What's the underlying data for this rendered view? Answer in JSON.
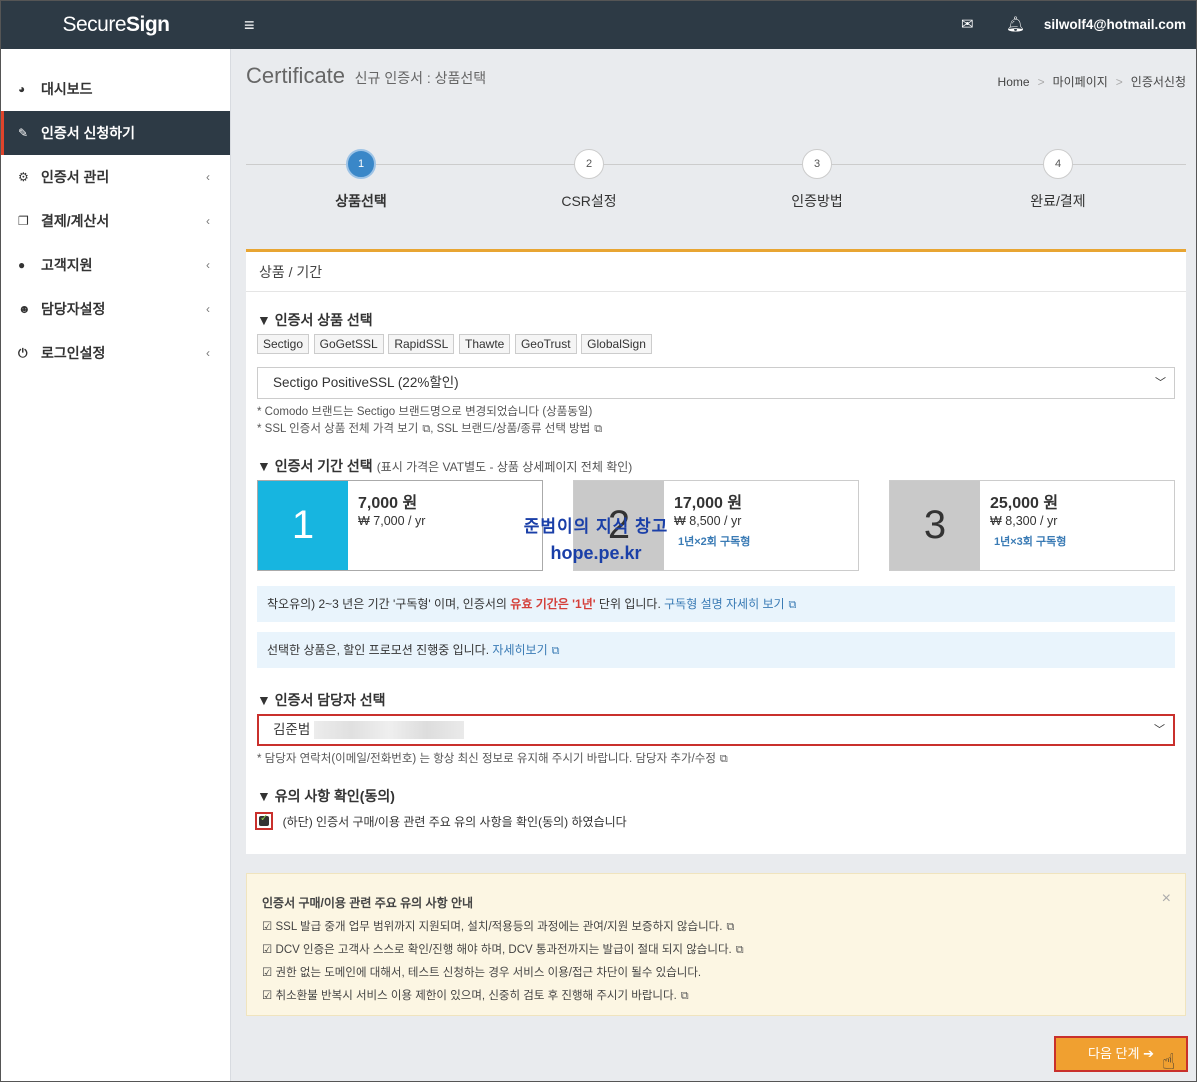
{
  "header": {
    "brand_light": "Secure",
    "brand_bold": "Sign",
    "menu_icon": "hamburger-icon",
    "mail_icon": "envelope-icon",
    "bell_icon": "bell-icon",
    "user_email": "silwolf4@hotmail.com"
  },
  "sidebar": {
    "items": [
      {
        "label": "대시보드",
        "icon": "dashboard-icon"
      },
      {
        "label": "인증서 신청하기",
        "icon": "edit-icon",
        "active": true
      },
      {
        "label": "인증서 관리",
        "icon": "cogs-icon"
      },
      {
        "label": "결제/계산서",
        "icon": "copy-icon"
      },
      {
        "label": "고객지원",
        "icon": "comments-icon"
      },
      {
        "label": "담당자설정",
        "icon": "users-icon"
      },
      {
        "label": "로그인설정",
        "icon": "power-icon"
      }
    ]
  },
  "page": {
    "title": "Certificate",
    "subtitle": "신규 인증서 : 상품선택",
    "breadcrumb": [
      "Home",
      "마이페이지",
      "인증서신청"
    ]
  },
  "steps": [
    {
      "num": "1",
      "label": "상품선택",
      "active": true
    },
    {
      "num": "2",
      "label": "CSR설정"
    },
    {
      "num": "3",
      "label": "인증방법"
    },
    {
      "num": "4",
      "label": "완료/결제"
    }
  ],
  "panel": {
    "header": "상품 / 기간",
    "product_section": {
      "title": "▼ 인증서 상품 선택",
      "brands": [
        "Sectigo",
        "GoGetSSL",
        "RapidSSL",
        "Thawte",
        "GeoTrust",
        "GlobalSign"
      ],
      "selected": "Sectigo PositiveSSL (22%할인)",
      "hint1": "* Comodo 브랜드는 Sectigo 브랜드명으로 변경되었습니다 (상품동일)",
      "hint2a": "* SSL 인증서 상품 전체 가격 보기",
      "hint2b": ", SSL 브랜드/상품/종류 선택 방법"
    },
    "period_section": {
      "title": "▼ 인증서 기간 선택",
      "note": "(표시 가격은 VAT별도 - 상품 상세페이지 전체 확인)",
      "options": [
        {
          "num": "1",
          "price": "7,000 원",
          "per_year": "₩ 7,000 / yr",
          "sub": "",
          "active": true
        },
        {
          "num": "2",
          "price": "17,000 원",
          "per_year": "₩ 8,500 / yr",
          "sub": "1년×2회 구독형"
        },
        {
          "num": "3",
          "price": "25,000 원",
          "per_year": "₩ 8,300 / yr",
          "sub": "1년×3회 구독형"
        }
      ],
      "info1_a": "착오유의) 2~3 년은 기간 '구독형' 이며, 인증서의 ",
      "info1_red": "유효 기간은 '1년'",
      "info1_b": " 단위 입니다. ",
      "info1_link": "구독형 설명 자세히 보기",
      "info2_a": "선택한 상품은, 할인 프로모션 진행중 입니다. ",
      "info2_link": "자세히보기"
    },
    "contact_section": {
      "title": "▼ 인증서 담당자 선택",
      "selected": "김준범",
      "hint": "* 담당자 연락처(이메일/전화번호) 는 항상 최신 정보로 유지해 주시기 바랍니다. 담당자 추가/수정"
    },
    "agree_section": {
      "title": "▼ 유의 사항 확인(동의)",
      "checked": true,
      "label": "(하단) 인증서 구매/이용 관련 주요 유의 사항을 확인(동의) 하였습니다"
    }
  },
  "watermark": {
    "line1": "준범이의 지식 창고",
    "line2": "hope.pe.kr"
  },
  "notice": {
    "title": "인증서 구매/이용 관련 주요 유의 사항 안내",
    "lines": [
      "SSL 발급 중개 업무 범위까지 지원되며, 설치/적용등의 과정에는 관여/지원 보증하지 않습니다.",
      "DCV 인증은 고객사 스스로 확인/진행 해야 하며, DCV 통과전까지는 발급이 절대 되지 않습니다.",
      "권한 없는 도메인에 대해서, 테스트 신청하는 경우 서비스 이용/접근 차단이 될수 있습니다.",
      "취소환불 반복시 서비스 이용 제한이 있으며, 신중히 검토 후 진행해 주시기 바랍니다."
    ],
    "close": "×"
  },
  "next_button": "다음 단계 ➔",
  "colors": {
    "topbar": "#2d3a45",
    "accent_orange": "#f0a030",
    "step_active": "#3a87c8",
    "option_active": "#17b5e0",
    "highlight_red": "#c9302c"
  }
}
